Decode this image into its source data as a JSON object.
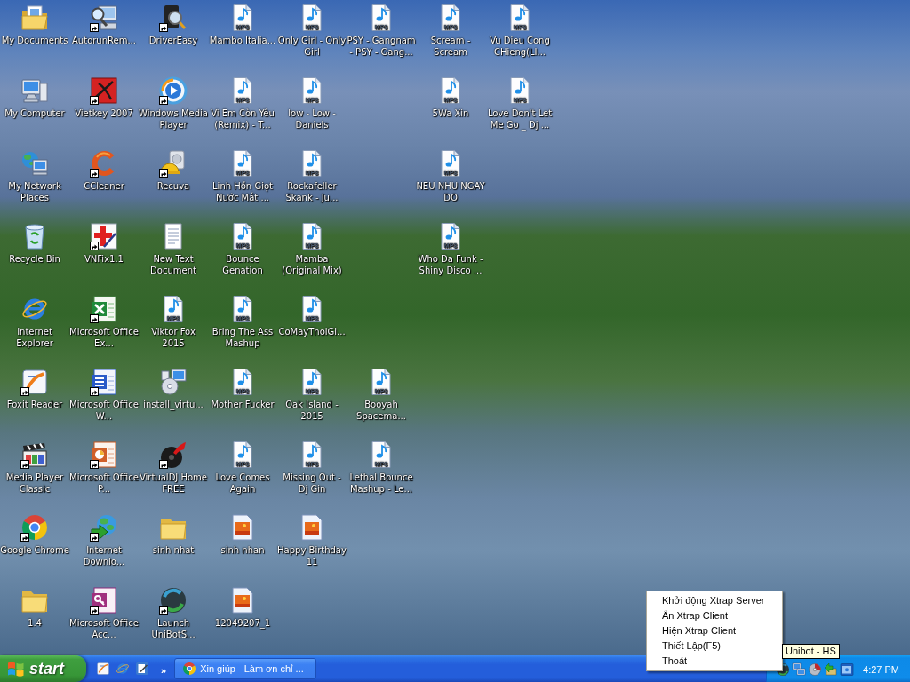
{
  "desktop": {
    "columns": [
      {
        "icons": [
          {
            "label": "My Documents",
            "kind": "documents",
            "shortcut": false
          },
          {
            "label": "My Computer",
            "kind": "computer",
            "shortcut": false
          },
          {
            "label": "My Network Places",
            "kind": "network",
            "shortcut": false
          },
          {
            "label": "Recycle Bin",
            "kind": "recycle-bin",
            "shortcut": false
          },
          {
            "label": "Internet Explorer",
            "kind": "ie",
            "shortcut": false
          },
          {
            "label": "Foxit Reader",
            "kind": "foxit",
            "shortcut": true
          },
          {
            "label": "Media Player Classic",
            "kind": "mpc",
            "shortcut": true
          },
          {
            "label": "Google Chrome",
            "kind": "chrome",
            "shortcut": true
          },
          {
            "label": "1.4",
            "kind": "folder",
            "shortcut": false
          }
        ]
      },
      {
        "icons": [
          {
            "label": "AutorunRem...",
            "kind": "autorun",
            "shortcut": true
          },
          {
            "label": "Vietkey 2007",
            "kind": "vietkey",
            "shortcut": true
          },
          {
            "label": "CCleaner",
            "kind": "ccleaner",
            "shortcut": true
          },
          {
            "label": "VNFix1.1",
            "kind": "vnfix",
            "shortcut": true
          },
          {
            "label": "Microsoft Office Ex...",
            "kind": "excel",
            "shortcut": true
          },
          {
            "label": "Microsoft Office W...",
            "kind": "word",
            "shortcut": true
          },
          {
            "label": "Microsoft Office P...",
            "kind": "powerpoint",
            "shortcut": true
          },
          {
            "label": "Internet Downlo...",
            "kind": "idm",
            "shortcut": true
          },
          {
            "label": "Microsoft Office Acc...",
            "kind": "access",
            "shortcut": true
          }
        ]
      },
      {
        "icons": [
          {
            "label": "DriverEasy",
            "kind": "drivereasy",
            "shortcut": true
          },
          {
            "label": "Windows Media Player",
            "kind": "wmp",
            "shortcut": true
          },
          {
            "label": "Recuva",
            "kind": "recuva",
            "shortcut": true
          },
          {
            "label": "New Text Document",
            "kind": "text",
            "shortcut": false
          },
          {
            "label": "Viktor Fox 2015",
            "kind": "mp3",
            "badge": "MP3",
            "shortcut": false
          },
          {
            "label": "install_virtu...",
            "kind": "install",
            "shortcut": false
          },
          {
            "label": "VirtualDJ Home FREE",
            "kind": "virtualdj",
            "shortcut": true
          },
          {
            "label": "sinh nhat",
            "kind": "folder",
            "shortcut": false
          },
          {
            "label": "Launch UniBotS...",
            "kind": "unibot",
            "shortcut": true
          }
        ]
      },
      {
        "icons": [
          {
            "label": "Mambo Italia...",
            "kind": "mp3",
            "badge": "MP3",
            "shortcut": false
          },
          {
            "label": "Vi Em Còn Yêu (Remix) - T...",
            "kind": "mp3",
            "badge": "MP3",
            "shortcut": false
          },
          {
            "label": "Linh Hồn Giọt Nước Mắt ...",
            "kind": "mp3",
            "badge": "MP3",
            "shortcut": false
          },
          {
            "label": "Bounce Genation",
            "kind": "mp3",
            "badge": "MP3",
            "shortcut": false
          },
          {
            "label": "Bring The Ass Mashup",
            "kind": "mp3",
            "badge": "MP3",
            "shortcut": false
          },
          {
            "label": "Mother Fucker",
            "kind": "mp3",
            "badge": "MP3",
            "shortcut": false
          },
          {
            "label": "Love Comes Again",
            "kind": "mp3",
            "badge": "MP3",
            "shortcut": false
          },
          {
            "label": "sinh nhan",
            "kind": "image",
            "shortcut": false
          },
          {
            "label": "12049207_1",
            "kind": "image",
            "shortcut": false
          }
        ]
      },
      {
        "icons": [
          {
            "label": "Only Girl - Only Girl",
            "kind": "mp3",
            "badge": "MP3",
            "shortcut": false
          },
          {
            "label": "low - Low - Daniels",
            "kind": "mp3",
            "badge": "MP3",
            "shortcut": false
          },
          {
            "label": "Rockafeller Skank - Ju...",
            "kind": "mp3",
            "badge": "MP3",
            "shortcut": false
          },
          {
            "label": "Mamba (Original Mix)",
            "kind": "mp3",
            "badge": "MP3",
            "shortcut": false
          },
          {
            "label": "CoMayThoiGi...",
            "kind": "mp3",
            "badge": "MP3",
            "shortcut": false
          },
          {
            "label": "Oak Island - 2015",
            "kind": "mp3",
            "badge": "MP3",
            "shortcut": false
          },
          {
            "label": "Missing Out - Dj Gin",
            "kind": "mp3",
            "badge": "MP3",
            "shortcut": false
          },
          {
            "label": "Happy Birthday 11",
            "kind": "image",
            "shortcut": false
          }
        ]
      },
      {
        "icons": [
          {
            "label": "PSY - Gangnam - PSY - Gang...",
            "kind": "mp3",
            "badge": "MP3",
            "shortcut": false
          },
          {
            "label": "Booyah Spacema...",
            "kind": "mp3",
            "badge": "MP3",
            "shortcut": false
          },
          {
            "label": "Lethal Bounce Mashup - Le...",
            "kind": "mp3",
            "badge": "MP3",
            "shortcut": false
          }
        ]
      },
      {
        "icons": [
          {
            "label": "Scream - Scream",
            "kind": "mp3",
            "badge": "MP3",
            "shortcut": false
          },
          {
            "label": "5Wa Xin",
            "kind": "mp3",
            "badge": "MP3",
            "shortcut": false
          },
          {
            "label": "NEU NHU NGAY DO",
            "kind": "mp3",
            "badge": "MP3",
            "shortcut": false
          },
          {
            "label": "Who Da Funk - Shiny Disco ...",
            "kind": "mp3",
            "badge": "MP3",
            "shortcut": false
          }
        ]
      },
      {
        "icons": [
          {
            "label": "Vu Dieu Cong CHieng(LI...",
            "kind": "mp3",
            "badge": "MP3",
            "shortcut": false
          },
          {
            "label": "Love Don't Let Me Go _ Dj ...",
            "kind": "mp3",
            "badge": "MP3",
            "shortcut": false
          }
        ]
      }
    ]
  },
  "context_menu": {
    "items": [
      {
        "label": "Khởi động Xtrap Server"
      },
      {
        "label": "Ẩn Xtrap Client"
      },
      {
        "label": "Hiện Xtrap Client"
      },
      {
        "label": "Thiết Lập(F5)"
      },
      {
        "label": "Thoát"
      }
    ]
  },
  "tooltip": {
    "text": "Unibot - HS"
  },
  "taskbar": {
    "start_button": "start",
    "quick_launch": [
      {
        "kind": "foxit"
      },
      {
        "kind": "ie"
      },
      {
        "kind": "editor"
      }
    ],
    "quick_launch_more": "»",
    "tasks": [
      {
        "kind": "chrome",
        "label": "Xin giúp - Làm ơn chỉ ...",
        "selected": false
      }
    ],
    "tray_icons": [
      {
        "kind": "unibot"
      },
      {
        "kind": "lan"
      },
      {
        "kind": "disc"
      },
      {
        "kind": "arrow"
      },
      {
        "kind": "window"
      }
    ],
    "clock": "4:27 PM"
  }
}
